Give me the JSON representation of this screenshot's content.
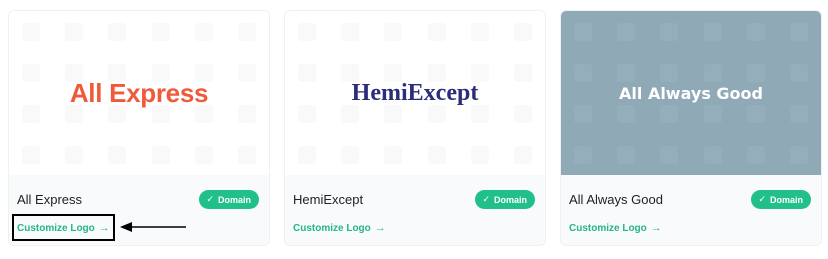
{
  "cards": [
    {
      "logo_text": "All Express",
      "name": "All Express",
      "badge": "Domain",
      "customize_label": "Customize Logo",
      "arrow": "→"
    },
    {
      "logo_text": "HemiExcept",
      "name": "HemiExcept",
      "badge": "Domain",
      "customize_label": "Customize Logo",
      "arrow": "→"
    },
    {
      "logo_text": "All Always Good",
      "name": "All Always Good",
      "badge": "Domain",
      "customize_label": "Customize Logo",
      "arrow": "→"
    }
  ],
  "icons": {
    "badge_check": "✓"
  },
  "colors": {
    "accent_green": "#21c08b",
    "link_green": "#26b585",
    "logo1": "#ef5b3a",
    "logo2": "#2b2d7a",
    "preview_dark": "#8fa9b7"
  }
}
